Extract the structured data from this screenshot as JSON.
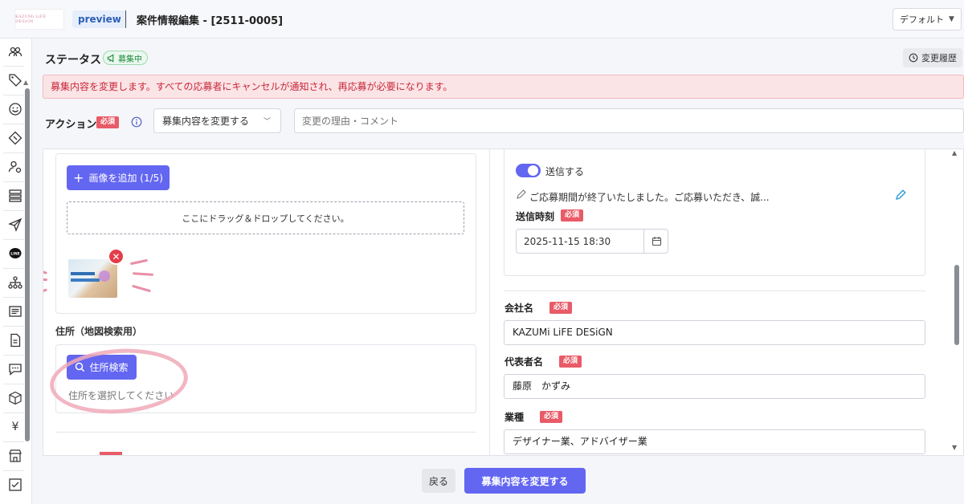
{
  "header": {
    "logo_text": "KAZUMi LiFE DESiGN",
    "preview_badge": "preview",
    "title": "案件情報編集 - [2511-0005]",
    "view_select": "デフォルト"
  },
  "status": {
    "label": "ステータス",
    "badge": "募集中",
    "history_button": "変更履歴"
  },
  "alert": {
    "message": "募集内容を変更します。すべての応募者にキャンセルが通知され、再応募が必要になります。"
  },
  "action": {
    "label": "アクション",
    "required": "必須",
    "select_value": "募集内容を変更する",
    "reason_placeholder": "変更の理由・コメント"
  },
  "images": {
    "add_button": "画像を追加 (1/5)",
    "dropzone_text": "ここにドラッグ＆ドロップしてください。"
  },
  "address": {
    "label": "住所（地図検索用）",
    "search_button": "住所検索",
    "hint": "住所を選択してください"
  },
  "notification": {
    "toggle_label": "送信する",
    "toggle_on": true,
    "message_preview": "ご応募期間が終了いたしました。ご応募いただき、誠...",
    "time_label": "送信時刻",
    "time_required": "必須",
    "datetime_value": "2025-11-15 18:30"
  },
  "fields": {
    "company": {
      "label": "会社名",
      "required": "必須",
      "value": "KAZUMi LiFE DESiGN"
    },
    "representative": {
      "label": "代表者名",
      "required": "必須",
      "value": "藤原　かずみ"
    },
    "industry": {
      "label": "業種",
      "required": "必須",
      "value": "デザイナー業、アドバイザー業"
    }
  },
  "footer": {
    "back_button": "戻る",
    "submit_button": "募集内容を変更する"
  },
  "colors": {
    "primary": "#6366f1",
    "danger": "#e85b67",
    "alert_bg": "#fbe4e6",
    "success": "#1f8a3c",
    "annotation_pink": "#f0a9b9"
  }
}
